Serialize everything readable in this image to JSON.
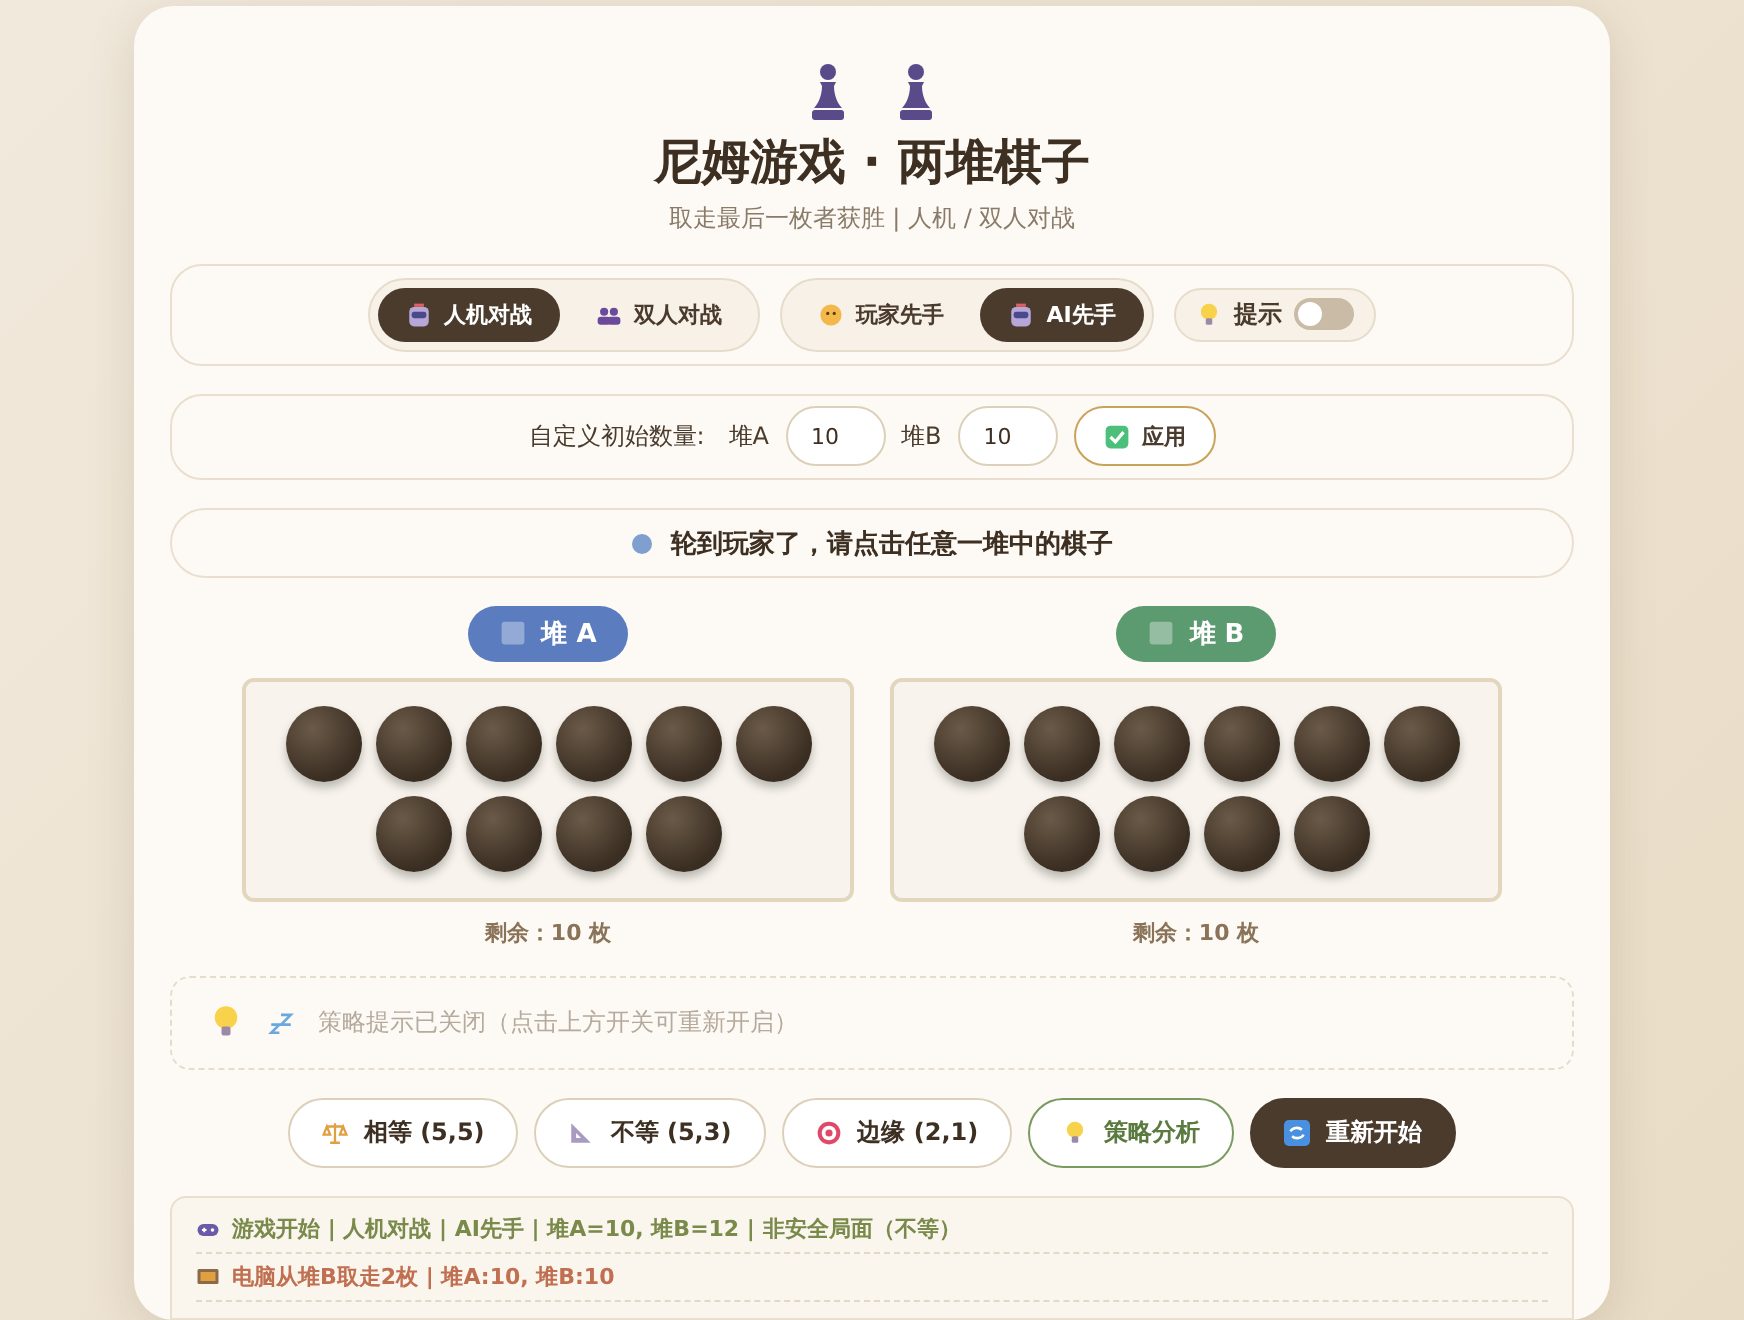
{
  "header": {
    "title": "尼姆游戏 · 两堆棋子",
    "subtitle": "取走最后一枚者获胜 | 人机 / 双人对战"
  },
  "modes": [
    {
      "label": "人机对战",
      "kind": "robot",
      "selected": true
    },
    {
      "label": "双人对战",
      "kind": "people",
      "selected": false
    }
  ],
  "first_move": [
    {
      "label": "玩家先手",
      "kind": "face",
      "selected": false
    },
    {
      "label": "AI先手",
      "kind": "robot",
      "selected": true
    }
  ],
  "hint_toggle": {
    "label": "提示",
    "on": false
  },
  "custom": {
    "label": "自定义初始数量:",
    "pile_a_label": "堆A",
    "pile_a_value": "10",
    "pile_b_label": "堆B",
    "pile_b_value": "10",
    "apply": "应用"
  },
  "status": {
    "text": "轮到玩家了，请点击任意一堆中的棋子",
    "color": "#7f9fd0"
  },
  "piles": [
    {
      "label": "堆 A",
      "color": "#5b7dc0",
      "remaining": "剩余：10 枚",
      "stones": [
        {
          "selected": false
        },
        {
          "selected": false
        },
        {
          "selected": false
        },
        {
          "selected": false
        },
        {
          "selected": false
        },
        {
          "selected": false
        },
        {
          "selected": false
        },
        {
          "selected": false
        },
        {
          "selected": false
        },
        {
          "selected": false
        }
      ]
    },
    {
      "label": "堆 B",
      "color": "#5c9a70",
      "remaining": "剩余：10 枚",
      "stones": [
        {
          "selected": false
        },
        {
          "selected": false
        },
        {
          "selected": false
        },
        {
          "selected": false
        },
        {
          "selected": false
        },
        {
          "selected": false
        },
        {
          "selected": false
        },
        {
          "selected": false
        },
        {
          "selected": false
        },
        {
          "selected": false
        }
      ]
    }
  ],
  "hint_panel": {
    "text": "策略提示已关闭（点击上方开关可重新开启）"
  },
  "actions": [
    {
      "label": "相等 (5,5)",
      "kind": "scales"
    },
    {
      "label": "不等 (5,3)",
      "kind": "ruler"
    },
    {
      "label": "边缘 (2,1)",
      "kind": "target"
    },
    {
      "label": "策略分析",
      "kind": "analysis"
    },
    {
      "label": "重新开始",
      "kind": "restart"
    }
  ],
  "log": [
    {
      "text": "游戏开始 | 人机对战 | AI先手 | 堆A=10, 堆B=12 | 非安全局面（不等）",
      "kind": "start"
    },
    {
      "text": "电脑从堆B取走2枚 | 堆A:10, 堆B:10",
      "kind": "computer"
    }
  ]
}
